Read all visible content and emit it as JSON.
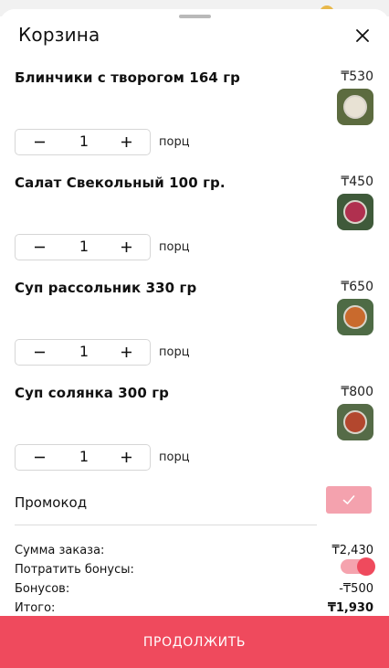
{
  "sheet": {
    "title": "Корзина"
  },
  "items": [
    {
      "name": "Блинчики с творогом 164 гр",
      "price": "₸530",
      "quantity": "1",
      "unit": "порц",
      "thumb_colors": [
        "#5c6b3f",
        "#e8e2d4"
      ]
    },
    {
      "name": "Салат Свекольный 100 гр.",
      "price": "₸450",
      "quantity": "1",
      "unit": "порц",
      "thumb_colors": [
        "#3f5a3a",
        "#b0304f"
      ]
    },
    {
      "name": "Суп рассольник 330 гр",
      "price": "₸650",
      "quantity": "1",
      "unit": "порц",
      "thumb_colors": [
        "#4e6b45",
        "#c96a2d"
      ]
    },
    {
      "name": "Суп солянка 300 гр",
      "price": "₸800",
      "quantity": "1",
      "unit": "порц",
      "thumb_colors": [
        "#556b47",
        "#b3472e"
      ]
    }
  ],
  "promo": {
    "label": "Промокод"
  },
  "summary": {
    "order_sum_label": "Сумма заказа:",
    "order_sum_value": "₸2,430",
    "spend_bonus_label": "Потратить бонусы:",
    "spend_bonus_enabled": true,
    "bonus_label": "Бонусов:",
    "bonus_value": "-₸500",
    "total_label": "Итого:",
    "total_value": "₸1,930"
  },
  "actions": {
    "continue_label": "ПРОДОЛЖИТЬ"
  },
  "colors": {
    "accent": "#ef4a5d",
    "accent_light": "#f5a3ae"
  },
  "icons": {
    "close": "close-icon",
    "minus": "minus-icon",
    "plus": "plus-icon",
    "check": "check-icon"
  }
}
